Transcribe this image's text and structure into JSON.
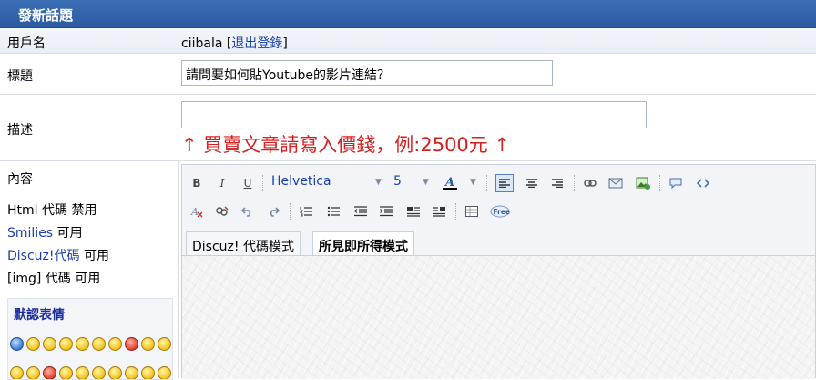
{
  "header": {
    "title": "發新話題"
  },
  "user_row": {
    "label": "用戶名",
    "username": "ciibala",
    "bracket_open": " [",
    "logout": "退出登錄",
    "bracket_close": "]"
  },
  "subject_row": {
    "label": "標題",
    "value": "請問要如何貼Youtube的影片連結？"
  },
  "desc_row": {
    "label": "描述",
    "value": "",
    "hint": "↑ 買賣文章請寫入價錢，例:2500元 ↑"
  },
  "content": {
    "label": "內容",
    "permissions": [
      {
        "name": "Html 代碼",
        "state": " 禁用"
      },
      {
        "name": "Smilies",
        "state": " 可用"
      },
      {
        "name": "Discuz!代碼",
        "state": " 可用"
      },
      {
        "name": "[img] 代碼",
        "state": " 可用"
      }
    ],
    "smilies_title": "默認表情"
  },
  "editor": {
    "font": "Helvetica",
    "size": "5",
    "tabs": [
      "Discuz! 代碼模式",
      "所見即所得模式"
    ],
    "toolbar_row1": [
      "B",
      "I",
      "U"
    ],
    "free_label": "Free"
  },
  "colors": {
    "header": "#2a5aa2",
    "hint": "#d42020",
    "link": "#1a3fb0"
  }
}
